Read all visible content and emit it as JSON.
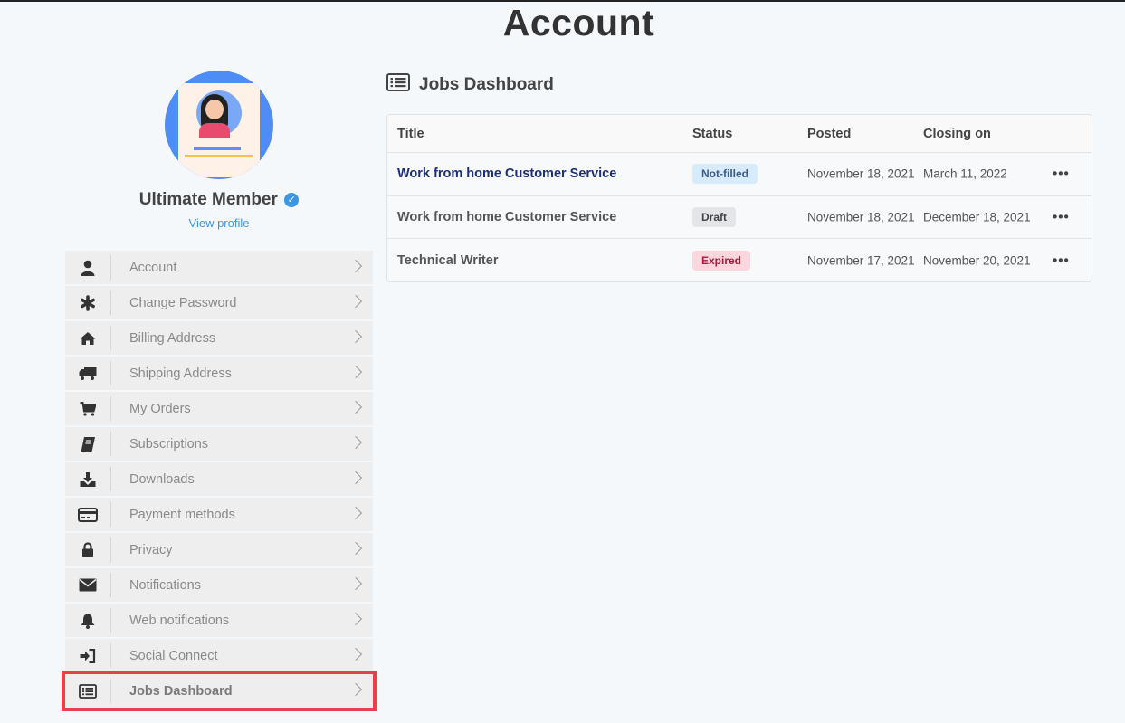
{
  "page": {
    "title": "Account"
  },
  "profile": {
    "name": "Ultimate Member",
    "view_profile": "View profile"
  },
  "nav": {
    "items": [
      {
        "label": "Account",
        "icon": "user-icon"
      },
      {
        "label": "Change Password",
        "icon": "asterisk-icon"
      },
      {
        "label": "Billing Address",
        "icon": "home-icon"
      },
      {
        "label": "Shipping Address",
        "icon": "truck-icon"
      },
      {
        "label": "My Orders",
        "icon": "cart-icon"
      },
      {
        "label": "Subscriptions",
        "icon": "book-icon"
      },
      {
        "label": "Downloads",
        "icon": "download-icon"
      },
      {
        "label": "Payment methods",
        "icon": "credit-card-icon"
      },
      {
        "label": "Privacy",
        "icon": "lock-icon"
      },
      {
        "label": "Notifications",
        "icon": "envelope-icon"
      },
      {
        "label": "Web notifications",
        "icon": "bell-icon"
      },
      {
        "label": "Social Connect",
        "icon": "sign-in-icon"
      },
      {
        "label": "Jobs Dashboard",
        "icon": "list-alt-icon",
        "active": true
      }
    ]
  },
  "jobs": {
    "title": "Jobs Dashboard",
    "columns": [
      "Title",
      "Status",
      "Posted",
      "Closing on"
    ],
    "rows": [
      {
        "title": "Work from home Customer Service",
        "status": "Not-filled",
        "posted": "November 18, 2021",
        "closing": "March 11, 2022",
        "actions": "•••"
      },
      {
        "title": "Work from home Customer Service",
        "status": "Draft",
        "posted": "November 18, 2021",
        "closing": "December 18, 2021",
        "actions": "•••"
      },
      {
        "title": "Technical Writer",
        "status": "Expired",
        "posted": "November 17, 2021",
        "closing": "November 20, 2021",
        "actions": "•••"
      }
    ]
  },
  "colors": {
    "accent": "#3b97e6",
    "highlight": "#e8414a",
    "link": "#1c2d7a"
  }
}
